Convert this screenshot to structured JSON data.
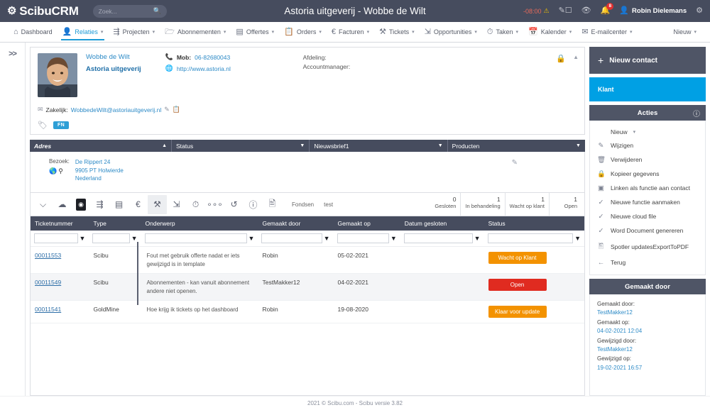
{
  "topbar": {
    "brand": "ScibuCRM",
    "brand_icon": "gear-logo-icon",
    "search_placeholder": "Zoek...",
    "search_value": "",
    "app_title": "Astoria uitgeverij - Wobbe de Wilt",
    "timezone": "-08:00",
    "warn_icon": "warning-triangle-icon",
    "compose_icon": "compose-icon",
    "eye_icon": "eye-icon",
    "bell_icon": "bell-icon",
    "notification_count": "8",
    "user_icon": "user-avatar-icon",
    "user_name": "Robin Dielemans",
    "settings_icon": "gear-icon"
  },
  "nav": {
    "items": [
      {
        "label": "Dashboard",
        "icon": "home-icon",
        "caret": false,
        "active": false
      },
      {
        "label": "Relaties",
        "icon": "person-icon",
        "caret": true,
        "active": true
      },
      {
        "label": "Projecten",
        "icon": "sitemap-icon",
        "caret": true,
        "active": false
      },
      {
        "label": "Abonnementen",
        "icon": "folder-icon",
        "caret": true,
        "active": false
      },
      {
        "label": "Offertes",
        "icon": "calculator-icon",
        "caret": true,
        "active": false
      },
      {
        "label": "Orders",
        "icon": "clipboard-icon",
        "caret": true,
        "active": false
      },
      {
        "label": "Facturen",
        "icon": "euro-icon",
        "caret": true,
        "active": false
      },
      {
        "label": "Tickets",
        "icon": "tools-icon",
        "caret": true,
        "active": false
      },
      {
        "label": "Opportunities",
        "icon": "handshake-icon",
        "caret": true,
        "active": false
      },
      {
        "label": "Taken",
        "icon": "clock-icon",
        "caret": true,
        "active": false
      },
      {
        "label": "Kalender",
        "icon": "calendar-icon",
        "caret": true,
        "active": false
      },
      {
        "label": "E-mailcenter",
        "icon": "envelope-icon",
        "caret": true,
        "active": false
      }
    ],
    "new_label": "Nieuw"
  },
  "left_rail": {
    "expand_label": ">>"
  },
  "contact": {
    "name": "Wobbe de Wilt",
    "company": "Astoria uitgeverij",
    "mobile_label": "Mob:",
    "mobile_value": "06-82680043",
    "mobile_icon": "phone-icon",
    "website": "http://www.astoria.nl",
    "website_icon": "globe-icon",
    "department_label": "Afdeling:",
    "accountmanager_label": "Accountmanager:",
    "email_label": "Zakelijk:",
    "email_icon": "envelope-icon",
    "email_value": "WobbedeWilt@astoriauitgeverij.nl",
    "edit_icon": "pencil-icon",
    "copy_icon": "copy-icon",
    "lock_icon": "lock-icon",
    "collapse_icon": "caret-up-icon",
    "tag_icon": "tag-icon",
    "tag_label": "FN"
  },
  "accordion": [
    {
      "label": "Adres",
      "chevron": "chevron-up-icon"
    },
    {
      "label": "Status",
      "chevron": "chevron-down-icon"
    },
    {
      "label": "Nieuwsbrief1",
      "chevron": "chevron-down-icon"
    },
    {
      "label": "Producten",
      "chevron": "chevron-down-icon"
    }
  ],
  "address": {
    "label": "Bezoek:",
    "icons": "globe-and-map-icon",
    "lines": [
      "De Rippert 24",
      "9905 PT Holwierde",
      "Nederland"
    ],
    "edit_icon": "pencil-icon"
  },
  "toolbar": {
    "icons": [
      {
        "name": "note-icon",
        "glyph": "◱",
        "state": "normal"
      },
      {
        "name": "upload-cloud-icon",
        "glyph": "☁",
        "state": "normal"
      },
      {
        "name": "ticket-dark-icon",
        "glyph": "●",
        "state": "dark"
      },
      {
        "name": "sitemap-icon",
        "glyph": "⛓",
        "state": "normal"
      },
      {
        "name": "calculator-icon",
        "glyph": "▤",
        "state": "normal"
      },
      {
        "name": "euro-icon",
        "glyph": "€",
        "state": "normal"
      },
      {
        "name": "tools-icon",
        "glyph": "⚒",
        "state": "selected"
      },
      {
        "name": "handshake-icon",
        "glyph": "☈",
        "state": "normal"
      },
      {
        "name": "clock-icon",
        "glyph": "◷",
        "state": "normal"
      },
      {
        "name": "more-dots-icon",
        "glyph": "○○○",
        "state": "normal"
      },
      {
        "name": "history-icon",
        "glyph": "↺",
        "state": "normal"
      },
      {
        "name": "info-icon",
        "glyph": "ⓘ",
        "state": "normal"
      },
      {
        "name": "document-icon",
        "glyph": "▧",
        "state": "normal"
      }
    ],
    "labels": [
      "Fondsen",
      "test"
    ],
    "counters": [
      {
        "value": "0",
        "label": "Gesloten"
      },
      {
        "value": "1",
        "label": "In behandeling"
      },
      {
        "value": "1",
        "label": "Wacht op klant"
      },
      {
        "value": "1",
        "label": "Open"
      }
    ]
  },
  "table": {
    "columns": [
      "Ticketnummer",
      "Type",
      "Onderwerp",
      "Gemaakt door",
      "Gemaakt op",
      "Datum gesloten",
      "Status"
    ],
    "filters": [
      "",
      "",
      "",
      "",
      "",
      "",
      ""
    ],
    "filter_icon": "funnel-icon",
    "rows": [
      {
        "ticket": "00011553",
        "type": "Scibu",
        "subject": "Fout met gebruik offerte nadat er iets gewijzigd is in template",
        "created_by": "Robin",
        "created_on": "05-02-2021",
        "closed_on": "",
        "status": "Wacht op Klant",
        "status_color": "#f39200"
      },
      {
        "ticket": "00011549",
        "type": "Scibu",
        "subject": "Abonnementen - kan vanuit abonnement andere niet openen.",
        "created_by": "TestMakker12",
        "created_on": "04-02-2021",
        "closed_on": "",
        "status": "Open",
        "status_color": "#e02b20"
      },
      {
        "ticket": "00011541",
        "type": "GoldMine",
        "subject": "Hoe krijg ik tickets op het dashboard",
        "created_by": "Robin",
        "created_on": "19-08-2020",
        "closed_on": "",
        "status": "Klaar voor update",
        "status_color": "#f39200"
      }
    ]
  },
  "sidebar": {
    "new_contact": "Nieuw contact",
    "new_contact_icon": "plus-icon",
    "klant_label": "Klant",
    "acties_title": "Acties",
    "acties_info_icon": "info-icon",
    "actions": [
      {
        "label": "Nieuw",
        "icon": "",
        "caret": true,
        "sub": true
      },
      {
        "label": "Wijzigen",
        "icon": "edit-icon",
        "caret": false,
        "sub": false
      },
      {
        "label": "Verwijderen",
        "icon": "trash-icon",
        "caret": false,
        "sub": false
      },
      {
        "label": "Kopieer gegevens",
        "icon": "lock-icon",
        "caret": false,
        "sub": false
      },
      {
        "label": "Linken als functie aan contact",
        "icon": "link-icon",
        "caret": false,
        "sub": false
      },
      {
        "label": "Nieuwe functie aanmaken",
        "icon": "check-icon",
        "caret": false,
        "sub": false
      },
      {
        "label": "Nieuwe cloud file",
        "icon": "check-icon",
        "caret": false,
        "sub": false
      },
      {
        "label": "Word Document genereren",
        "icon": "check-icon",
        "caret": false,
        "sub": false
      },
      {
        "label": "Spotler updatesExportToPDF",
        "icon": "pdf-icon",
        "caret": false,
        "sub": false
      },
      {
        "label": "Terug",
        "icon": "arrow-left-icon",
        "caret": false,
        "sub": false
      }
    ],
    "gemaakt_title": "Gemaakt door",
    "meta": [
      {
        "key": "Gemaakt door:",
        "value": "TestMakker12"
      },
      {
        "key": "Gemaakt op:",
        "value": "04-02-2021 12:04"
      },
      {
        "key": "Gewijzigd door:",
        "value": "TestMakker12"
      },
      {
        "key": "Gewijzigd op:",
        "value": "19-02-2021 16:57"
      }
    ]
  },
  "footer": {
    "text": "2021 © Scibu.com - Scibu versie 3.82"
  },
  "colors": {
    "dark": "#464c5e",
    "accent_blue": "#00a0e4",
    "link_blue": "#2e8bc7",
    "orange": "#f39200",
    "red": "#e02b20"
  }
}
